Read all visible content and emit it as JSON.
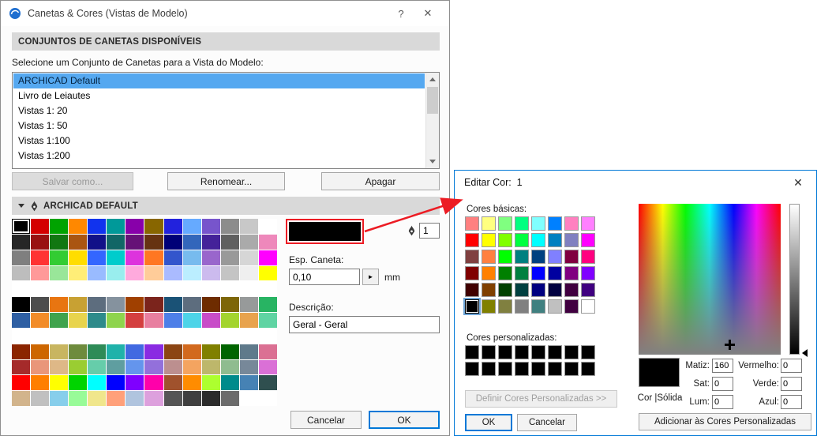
{
  "pens_dialog": {
    "title": "Canetas & Cores (Vistas de Modelo)",
    "help_label": "?",
    "close_label": "✕",
    "available_sets_header": "CONJUNTOS DE CANETAS DISPONÍVEIS",
    "select_label": "Selecione um Conjunto de Canetas para a Vista do Modelo:",
    "pen_sets": [
      "ARCHICAD Default",
      "Livro de Leiautes",
      "Vistas 1: 20",
      "Vistas 1: 50",
      "Vistas 1:100",
      "Vistas 1:200"
    ],
    "pen_sets_selected_index": 0,
    "save_as_label": "Salvar como...",
    "rename_label": "Renomear...",
    "delete_label": "Apagar",
    "current_set_header": "ARCHICAD DEFAULT",
    "pen_number": "1",
    "selected_pen_color": "#000000",
    "pen_width_label": "Esp. Caneta:",
    "pen_width_value": "0,10",
    "pen_width_unit": "mm",
    "flyout_glyph": "►",
    "description_label": "Descrição:",
    "description_value": "Geral - Geral",
    "cancel_label": "Cancelar",
    "ok_label": "OK",
    "pen_grid_selected_index": 0,
    "pen_grid": [
      [
        "#000000",
        "#d40000",
        "#00a300",
        "#ff8800",
        "#1133ee",
        "#009999",
        "#8800aa",
        "#886600",
        "#2222dd",
        "#66aaff",
        "#7755cc",
        "#8c8c8c",
        "#c8c8c8",
        "#ffffff"
      ],
      [
        "#262626",
        "#991111",
        "#117711",
        "#aa5511",
        "#111188",
        "#116666",
        "#661177",
        "#663311",
        "#000077",
        "#3366bb",
        "#442299",
        "#606060",
        "#aaaaaa",
        "#ee88bb"
      ],
      [
        "#7f7f7f",
        "#ff3333",
        "#33cc33",
        "#ffdd00",
        "#3366ff",
        "#00cccc",
        "#dd33dd",
        "#ff7722",
        "#3355cc",
        "#77bbee",
        "#9966cc",
        "#999999",
        "#d6d6d6",
        "#ff00ff"
      ],
      [
        "#bdbdbd",
        "#ff9999",
        "#99e699",
        "#ffee77",
        "#99bbff",
        "#99eeee",
        "#ffaadd",
        "#ffcc99",
        "#aabbff",
        "#bbeeff",
        "#ccbbee",
        "#c4c4c4",
        "#efefef",
        "#ffff00"
      ],
      [
        "#ffffff",
        "#ffffff",
        "#ffffff",
        "#ffffff",
        "#ffffff",
        "#ffffff",
        "#ffffff",
        "#ffffff",
        "#ffffff",
        "#ffffff",
        "#ffffff",
        "#ffffff",
        "#ffffff",
        "#ffffff"
      ],
      [
        "#000000",
        "#4d4d4d",
        "#e87511",
        "#c8a133",
        "#5d6d7e",
        "#85929e",
        "#a04000",
        "#7b241c",
        "#1a5276",
        "#5d6d7e",
        "#6e2c00",
        "#7d6608",
        "#979a9a",
        "#28b463"
      ],
      [
        "#2e5fa3",
        "#f28c28",
        "#3fa34d",
        "#e8d44d",
        "#2e8b8b",
        "#8fd44d",
        "#d43f3f",
        "#e87fa0",
        "#4d7fe8",
        "#4dd4e8",
        "#c84dc8",
        "#a3d42e",
        "#e8a34d",
        "#5fd4a3"
      ],
      [
        "#ffffff",
        "#ffffff",
        "#ffffff",
        "#ffffff",
        "#ffffff",
        "#ffffff",
        "#ffffff",
        "#ffffff",
        "#ffffff",
        "#ffffff",
        "#ffffff",
        "#ffffff",
        "#ffffff",
        "#ffffff"
      ],
      [
        "#8b2500",
        "#cd6600",
        "#c8b560",
        "#6e8b3d",
        "#2e8b57",
        "#20b2aa",
        "#4169e1",
        "#8a2be2",
        "#8b4513",
        "#d2691e",
        "#808000",
        "#006400",
        "#5f7a8b",
        "#db7093"
      ],
      [
        "#a52a2a",
        "#e9967a",
        "#deb887",
        "#9acd32",
        "#66cdaa",
        "#5f9ea0",
        "#6495ed",
        "#9370db",
        "#bc8f8f",
        "#f4a460",
        "#bdb76b",
        "#8fbc8f",
        "#778899",
        "#da70d6"
      ],
      [
        "#ff0000",
        "#ff7f00",
        "#ffff00",
        "#00d400",
        "#00ffff",
        "#0000ff",
        "#7f00ff",
        "#ff00aa",
        "#a0522d",
        "#ff8c00",
        "#adff2f",
        "#008b8b",
        "#4682b4",
        "#2f4f4f"
      ],
      [
        "#d2b48c",
        "#c0c0c0",
        "#87ceeb",
        "#98fb98",
        "#f0e68c",
        "#ffa07a",
        "#b0c4de",
        "#dda0dd",
        "#555555",
        "#3f3f3f",
        "#2b2b2b",
        "#6b6b6b",
        "#ffffff",
        "#ffffff"
      ]
    ]
  },
  "color_dialog": {
    "title": "Editar Cor:  1",
    "close_label": "✕",
    "basic_colors_label": "Cores básicas:",
    "custom_colors_label": "Cores personalizadas:",
    "define_custom_label": "Definir Cores Personalizadas >>",
    "ok_label": "OK",
    "cancel_label": "Cancelar",
    "add_custom_label": "Adicionar às Cores Personalizadas",
    "color_solid_label": "Cor |Sólida",
    "hue_label": "Matiz:",
    "hue_value": "160",
    "sat_label": "Sat:",
    "sat_value": "0",
    "lum_label": "Lum:",
    "lum_value": "0",
    "red_label": "Vermelho:",
    "red_value": "0",
    "green_label": "Verde:",
    "green_value": "0",
    "blue_label": "Azul:",
    "blue_value": "0",
    "preview_color": "#000000",
    "basic_selected_index": 40,
    "basic_colors": [
      [
        "#FF8080",
        "#FFFF80",
        "#80FF80",
        "#00FF80",
        "#80FFFF",
        "#0080FF",
        "#FF80C0",
        "#FF80FF"
      ],
      [
        "#FF0000",
        "#FFFF00",
        "#80FF00",
        "#00FF40",
        "#00FFFF",
        "#0080C0",
        "#8080C0",
        "#FF00FF"
      ],
      [
        "#804040",
        "#FF8040",
        "#00FF00",
        "#008080",
        "#004080",
        "#8080FF",
        "#800040",
        "#FF0080"
      ],
      [
        "#800000",
        "#FF8000",
        "#008000",
        "#008040",
        "#0000FF",
        "#0000A0",
        "#800080",
        "#8000FF"
      ],
      [
        "#400000",
        "#804000",
        "#004000",
        "#004040",
        "#000080",
        "#000040",
        "#400040",
        "#400080"
      ],
      [
        "#000000",
        "#808000",
        "#808040",
        "#808080",
        "#408080",
        "#C0C0C0",
        "#400040",
        "#FFFFFF"
      ]
    ],
    "custom_colors": [
      [
        "#000000",
        "#000000",
        "#000000",
        "#000000",
        "#000000",
        "#000000",
        "#000000",
        "#000000"
      ],
      [
        "#000000",
        "#000000",
        "#000000",
        "#000000",
        "#000000",
        "#000000",
        "#000000",
        "#000000"
      ]
    ]
  },
  "annotation": {
    "color": "#ec1c24"
  }
}
